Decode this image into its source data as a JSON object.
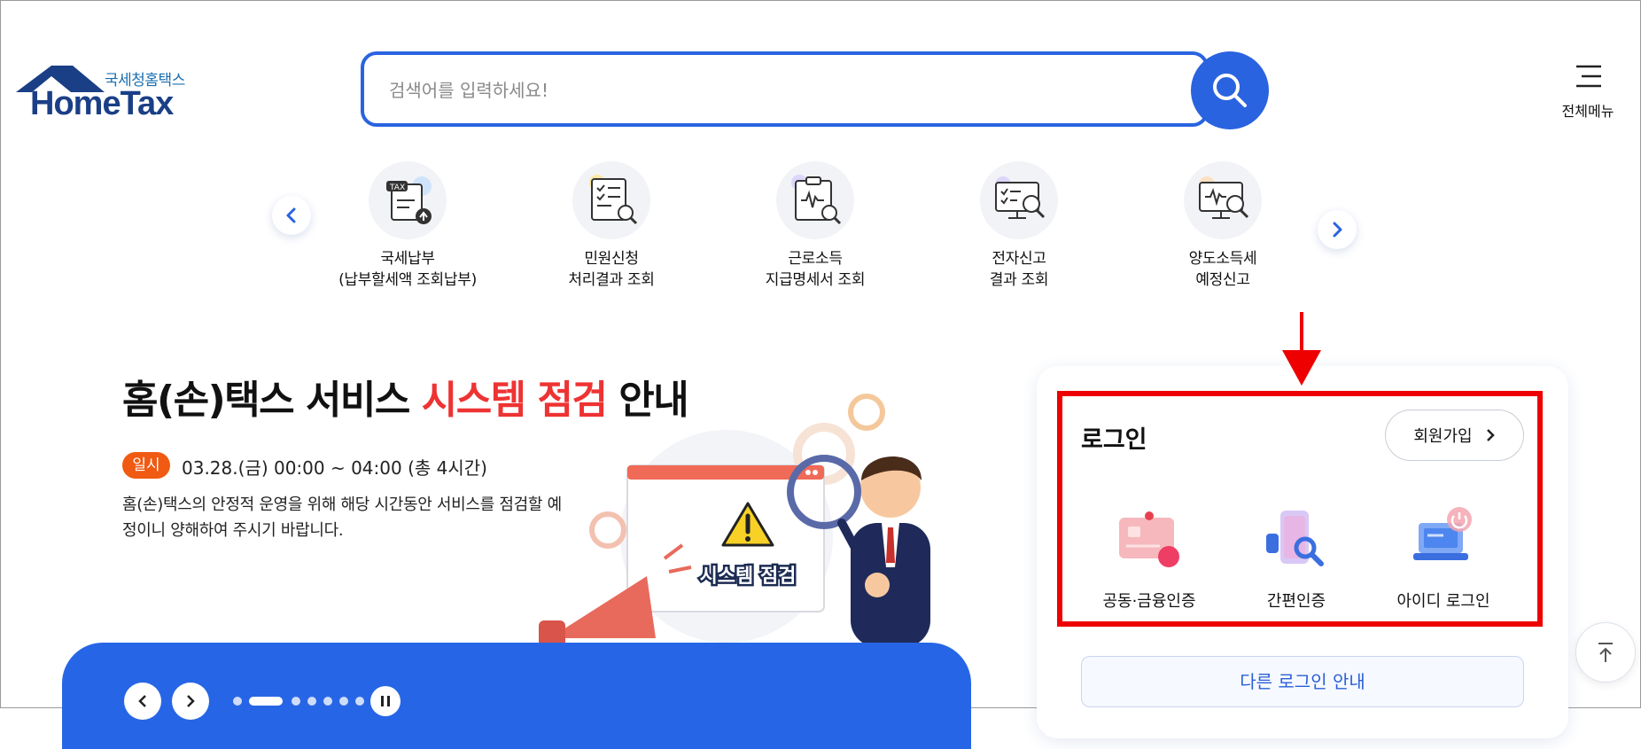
{
  "header": {
    "logo_sub": "국세청홈택스",
    "logo_main": "HomeTax",
    "search_placeholder": "검색어를 입력하세요!",
    "menu_label": "전체메뉴"
  },
  "quick_menu": [
    {
      "label": "국세납부\n(납부할세액 조회납부)",
      "icon": "tax-payment-icon"
    },
    {
      "label": "민원신청\n처리결과 조회",
      "icon": "document-search-icon"
    },
    {
      "label": "근로소득\n지급명세서 조회",
      "icon": "clipboard-search-icon"
    },
    {
      "label": "전자신고\n결과 조회",
      "icon": "monitor-check-icon"
    },
    {
      "label": "양도소득세\n예정신고",
      "icon": "monitor-search-icon"
    }
  ],
  "banner": {
    "title_prefix": "홈(손)택스 서비스 ",
    "title_highlight": "시스템 점검",
    "title_suffix": " 안내",
    "badge": "일시",
    "time": "03.28.(금) 00:00 ~ 04:00 (총 4시간)",
    "description": "홈(손)택스의 안정적 운영을 위해 해당 시간동안 서비스를 점검할 예정이니 양해하여 주시기 바랍니다.",
    "sign_text": "시스템 점검"
  },
  "login": {
    "title": "로그인",
    "signup_label": "회원가입",
    "options": [
      {
        "label": "공동·금융인증",
        "icon": "certificate-card-icon"
      },
      {
        "label": "간편인증",
        "icon": "phone-search-icon"
      },
      {
        "label": "아이디 로그인",
        "icon": "laptop-power-icon"
      }
    ],
    "other_login": "다른 로그인 안내"
  },
  "colors": {
    "primary": "#2a63e0",
    "brand": "#1b3f86",
    "alert_red": "#ee3333",
    "highlight_red": "#ee0000",
    "badge_orange": "#f05a12"
  }
}
